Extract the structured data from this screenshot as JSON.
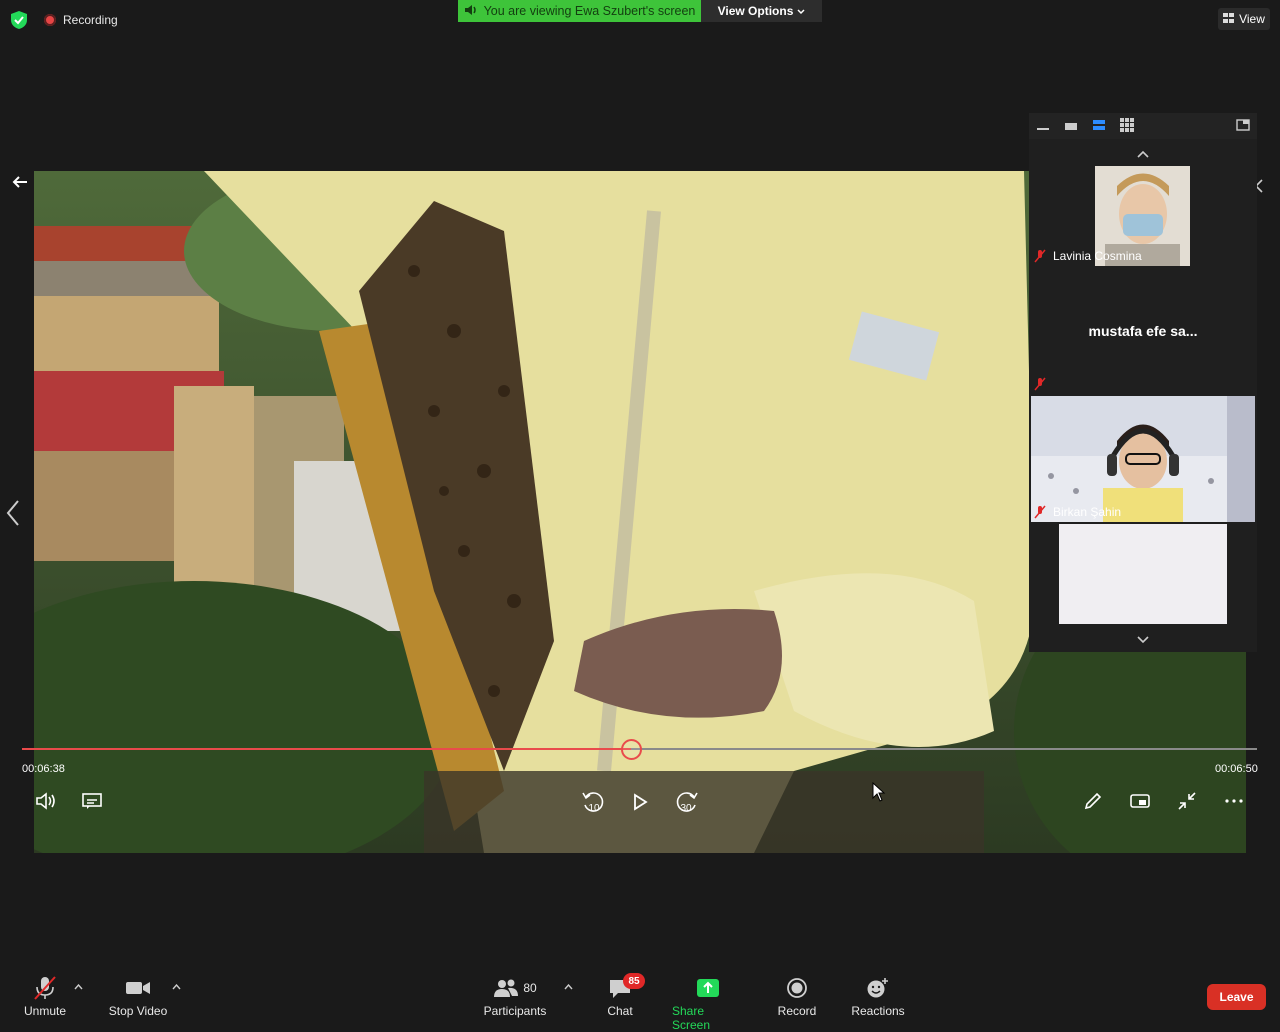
{
  "top_bar": {
    "recording_label": "Recording",
    "banner_text": "You are viewing Ewa Szubert's screen",
    "view_options_label": "View Options",
    "view_label": "View"
  },
  "player": {
    "current_time": "00:06:38",
    "end_time": "00:06:50",
    "progress_fraction": 0.493,
    "rewind_seconds": "10",
    "forward_seconds": "30"
  },
  "gallery": {
    "participants": [
      {
        "name": "Lavinia Cosmina",
        "muted": true,
        "has_video": true
      },
      {
        "name": "mustafa  efe  sa...",
        "muted": true,
        "has_video": false
      },
      {
        "name": "Birkan Şahin",
        "muted": true,
        "has_video": true
      },
      {
        "name": "",
        "muted": true,
        "has_video": true
      }
    ]
  },
  "toolbar": {
    "unmute_label": "Unmute",
    "stop_video_label": "Stop Video",
    "participants_label": "Participants",
    "participants_count": "80",
    "chat_label": "Chat",
    "chat_badge": "85",
    "share_screen_label": "Share Screen",
    "record_label": "Record",
    "reactions_label": "Reactions",
    "leave_label": "Leave"
  },
  "colors": {
    "banner_green": "#3ec43a",
    "progress_red": "#e94b4b",
    "leave_red": "#d93025",
    "share_green": "#23d959",
    "active_layout_blue": "#2d8cff"
  }
}
